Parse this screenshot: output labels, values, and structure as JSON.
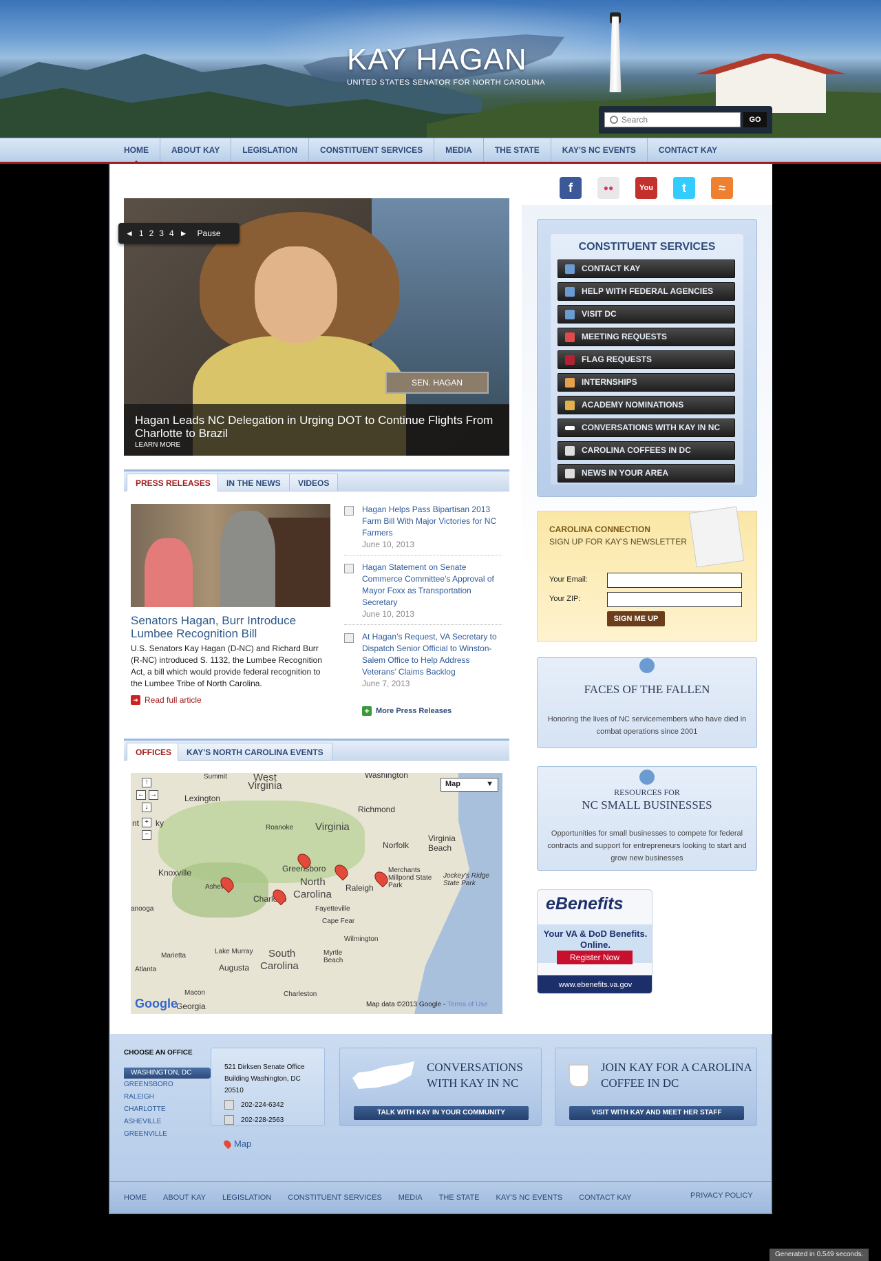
{
  "header": {
    "site_title": "KAY HAGAN",
    "site_subtitle": "UNITED STATES SENATOR FOR NORTH CAROLINA",
    "search_placeholder": "Search",
    "search_button": "GO"
  },
  "nav": [
    "HOME",
    "ABOUT KAY",
    "LEGISLATION",
    "CONSTITUENT SERVICES",
    "MEDIA",
    "THE STATE",
    "KAY'S NC EVENTS",
    "CONTACT KAY"
  ],
  "slider": {
    "controls": [
      "◄",
      "1",
      "2",
      "3",
      "4",
      "►",
      "Pause"
    ],
    "nameplate": "SEN. HAGAN",
    "caption_title": "Hagan Leads NC Delegation in Urging DOT to Continue Flights From Charlotte to Brazil",
    "caption_link": "LEARN MORE"
  },
  "news_tabs": [
    "PRESS RELEASES",
    "IN THE NEWS",
    "VIDEOS"
  ],
  "feature": {
    "title": "Senators Hagan, Burr Introduce Lumbee Recognition Bill",
    "body": "U.S. Senators Kay Hagan (D-NC) and Richard Burr (R-NC) introduced S. 1132, the Lumbee Recognition Act, a bill which would provide federal recognition to the Lumbee Tribe of North Carolina.",
    "read_more": "Read full article"
  },
  "press_releases": [
    {
      "title": "Hagan Helps Pass Bipartisan 2013 Farm Bill With Major Victories for NC Farmers",
      "date": "June 10, 2013"
    },
    {
      "title": "Hagan Statement on Senate Commerce Committee’s Approval of Mayor Foxx as Transportation Secretary",
      "date": "June 10, 2013"
    },
    {
      "title": "At Hagan’s Request, VA Secretary to Dispatch Senior Official to Winston-Salem Office to Help Address Veterans’ Claims Backlog",
      "date": "June 7, 2013"
    }
  ],
  "more_press": "More Press Releases",
  "office_tabs": [
    "OFFICES",
    "KAY'S NORTH CAROLINA EVENTS"
  ],
  "map": {
    "type_label": "Map",
    "credit": "Map data ©2013 Google -",
    "terms": "Terms of Use",
    "google": "Google",
    "labels": [
      "West",
      "Virginia",
      "Washington",
      "Summit",
      "Lexington",
      "Richmond",
      "Roanoke",
      "Virginia",
      "Norfolk",
      "Virginia Beach",
      "Knoxville",
      "Greensboro",
      "North",
      "Carolina",
      "Raleigh",
      "Merchants Millpond State Park",
      "Jockey's Ridge State Park",
      "Asheville",
      "Charlotte",
      "Fayetteville",
      "Cape Fear",
      "anooga",
      "Wilmington",
      "Marietta",
      "Lake Murray",
      "South",
      "Carolina",
      "Myrtle Beach",
      "Augusta",
      "Atlanta",
      "Macon",
      "Charleston",
      "Georgia",
      "nt",
      "ky"
    ]
  },
  "social": [
    {
      "name": "facebook",
      "glyph": "f",
      "color": "#3b5998"
    },
    {
      "name": "flickr",
      "glyph": "●●",
      "color": "#e8e8e8"
    },
    {
      "name": "youtube",
      "glyph": "You",
      "color": "#c4302b"
    },
    {
      "name": "twitter",
      "glyph": "t",
      "color": "#33ccff"
    },
    {
      "name": "rss",
      "glyph": "≈",
      "color": "#ee802f"
    }
  ],
  "constituent_services": {
    "title": "CONSTITUENT SERVICES",
    "items": [
      "CONTACT KAY",
      "HELP WITH FEDERAL AGENCIES",
      "VISIT DC",
      "MEETING REQUESTS",
      "FLAG REQUESTS",
      "INTERNSHIPS",
      "ACADEMY NOMINATIONS",
      "CONVERSATIONS WITH KAY IN NC",
      "CAROLINA COFFEES IN DC",
      "NEWS IN YOUR AREA"
    ]
  },
  "newsletter": {
    "title": "CAROLINA CONNECTION",
    "subtitle": "SIGN UP FOR KAY'S NEWSLETTER",
    "email_label": "Your Email:",
    "zip_label": "Your ZIP:",
    "submit": "SIGN ME UP"
  },
  "fallen": {
    "title": "FACES OF THE FALLEN",
    "body": "Honoring the lives of NC servicemembers who have died in combat operations since 2001"
  },
  "small_business": {
    "kicker": "RESOURCES FOR",
    "title": "NC SMALL BUSINESSES",
    "body": "Opportunities for small businesses to compete for federal contracts and support for entrepreneurs looking to start and grow new businesses"
  },
  "ebenefits": {
    "logo": "eBenefits",
    "tagline": "Your VA & DoD Benefits. Online.",
    "register": "Register Now",
    "url": "www.ebenefits.va.gov"
  },
  "offices": {
    "label": "CHOOSE AN OFFICE",
    "list": [
      "WASHINGTON, DC",
      "GREENSBORO",
      "RALEIGH",
      "CHARLOTTE",
      "ASHEVILLE",
      "GREENVILLE"
    ],
    "address": "521 Dirksen Senate Office Building Washington, DC 20510",
    "phone": "202-224-6342",
    "fax": "202-228-2563",
    "map_link": "Map"
  },
  "conversations": {
    "title": "CONVERSATIONS WITH KAY IN NC",
    "button": "TALK WITH KAY IN YOUR COMMUNITY"
  },
  "coffee": {
    "title": "JOIN KAY FOR A CAROLINA COFFEE IN DC",
    "button": "VISIT WITH KAY AND MEET HER STAFF"
  },
  "footer_nav": [
    "HOME",
    "ABOUT KAY",
    "LEGISLATION",
    "CONSTITUENT SERVICES",
    "MEDIA",
    "THE STATE",
    "KAY'S NC EVENTS",
    "CONTACT KAY"
  ],
  "privacy": "PRIVACY POLICY",
  "generated": "Generated in 0.549 seconds."
}
